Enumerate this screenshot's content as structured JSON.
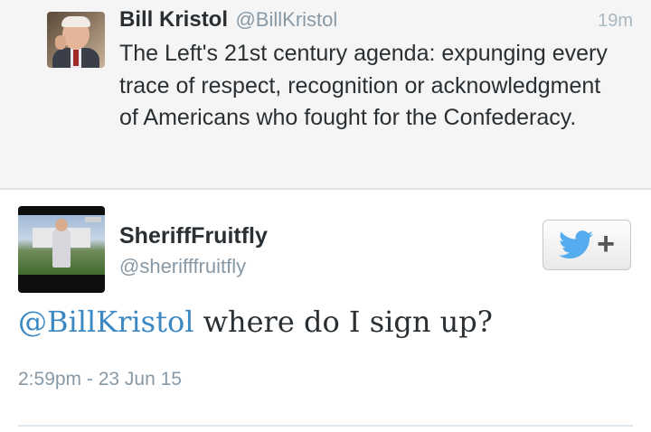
{
  "parent_tweet": {
    "display_name": "Bill Kristol",
    "screen_name": "@BillKristol",
    "relative_time": "19m",
    "text": "The Left's 21st century agenda: expunging every trace of respect, recognition or acknowledgment of Americans who fought for the Confederacy."
  },
  "reply_tweet": {
    "display_name": "SheriffFruitfly",
    "screen_name": "@sherifffruitfly",
    "follow_button": {
      "icon": "twitter-bird-icon",
      "plus": "+"
    },
    "mention": "@BillKristol",
    "text": " where do I sign up?",
    "timestamp": "2:59pm - 23 Jun 15"
  },
  "colors": {
    "mention_blue": "#3b88c3",
    "twitter_blue": "#55acee",
    "muted_gray": "#8899a6"
  }
}
